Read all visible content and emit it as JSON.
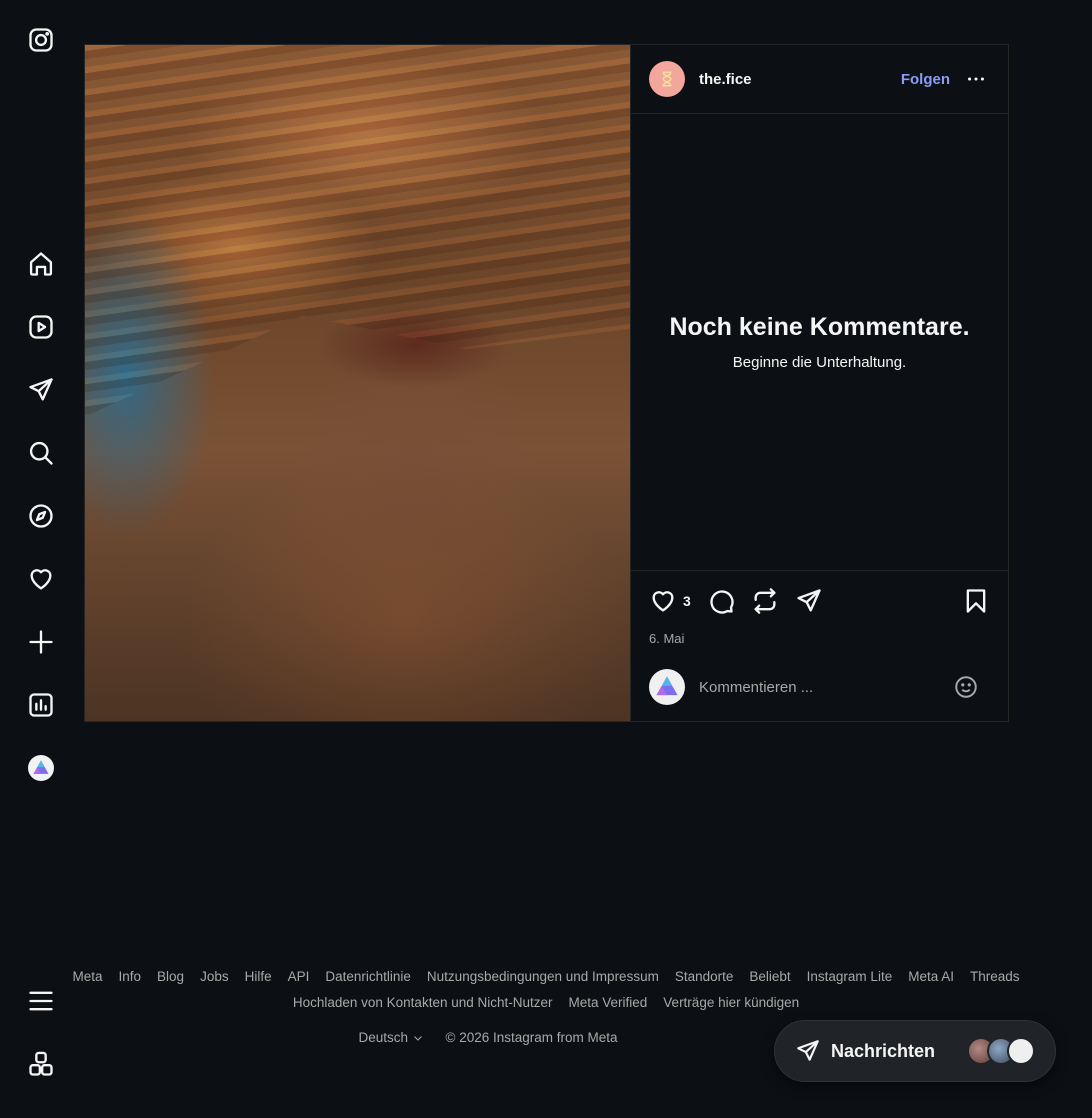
{
  "sidebar": {
    "items": [
      {
        "icon": "instagram-logo-icon"
      },
      {
        "icon": "home-icon"
      },
      {
        "icon": "reels-icon"
      },
      {
        "icon": "messages-send-icon"
      },
      {
        "icon": "search-icon"
      },
      {
        "icon": "explore-compass-icon"
      },
      {
        "icon": "heart-notifications-icon"
      },
      {
        "icon": "create-plus-icon"
      },
      {
        "icon": "dashboard-insights-icon"
      },
      {
        "icon": "profile-avatar"
      }
    ],
    "bottom": [
      {
        "icon": "menu-hamburger-icon"
      },
      {
        "icon": "also-from-meta-icon"
      }
    ]
  },
  "post": {
    "author": "the.fice",
    "follow_label": "Folgen",
    "empty_title": "Noch keine Kommentare.",
    "empty_subtitle": "Beginne die Unterhaltung.",
    "like_count": "3",
    "date": "6. Mai",
    "comment_placeholder": "Kommentieren ..."
  },
  "footer": {
    "links_row1": [
      "Meta",
      "Info",
      "Blog",
      "Jobs",
      "Hilfe",
      "API",
      "Datenrichtlinie",
      "Nutzungsbedingungen und Impressum",
      "Standorte",
      "Beliebt",
      "Instagram Lite",
      "Meta AI",
      "Threads"
    ],
    "links_row2": [
      "Hochladen von Kontakten und Nicht-Nutzer",
      "Meta Verified",
      "Verträge hier kündigen"
    ],
    "language": "Deutsch",
    "copyright": "© 2026 Instagram from Meta"
  },
  "messages": {
    "label": "Nachrichten"
  },
  "colors": {
    "background": "#0c1014",
    "accent_link": "#8b9cf7",
    "border": "#262626"
  }
}
